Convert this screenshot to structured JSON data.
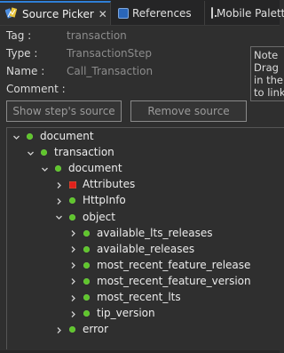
{
  "tabs": [
    {
      "label": "Source Picker",
      "active": true,
      "icon": "source-picker-icon"
    },
    {
      "label": "References",
      "active": false,
      "icon": "references-icon"
    },
    {
      "label": "Mobile Palette",
      "active": false,
      "icon": "mobile-palette-icon"
    }
  ],
  "properties": {
    "tag": {
      "label": "Tag :",
      "value": "transaction"
    },
    "type": {
      "label": "Type :",
      "value": "TransactionStep"
    },
    "name": {
      "label": "Name :",
      "value": "Call_Transaction"
    },
    "comment": {
      "label": "Comment :"
    }
  },
  "note": {
    "lines": [
      "Note",
      "Drag",
      "in the",
      "to link"
    ]
  },
  "buttons": {
    "show_source": "Show step's source",
    "remove_source": "Remove source"
  },
  "tree": [
    {
      "label": "document",
      "depth": 0,
      "expanded": true,
      "icon": "green-dot"
    },
    {
      "label": "transaction",
      "depth": 1,
      "expanded": true,
      "icon": "green-dot"
    },
    {
      "label": "document",
      "depth": 2,
      "expanded": true,
      "icon": "green-dot"
    },
    {
      "label": "Attributes",
      "depth": 3,
      "expanded": false,
      "icon": "red-square"
    },
    {
      "label": "HttpInfo",
      "depth": 3,
      "expanded": false,
      "icon": "green-dot"
    },
    {
      "label": "object",
      "depth": 3,
      "expanded": true,
      "icon": "green-dot"
    },
    {
      "label": "available_lts_releases",
      "depth": 4,
      "expanded": false,
      "icon": "green-dot"
    },
    {
      "label": "available_releases",
      "depth": 4,
      "expanded": false,
      "icon": "green-dot"
    },
    {
      "label": "most_recent_feature_release",
      "depth": 4,
      "expanded": false,
      "icon": "green-dot"
    },
    {
      "label": "most_recent_feature_version",
      "depth": 4,
      "expanded": false,
      "icon": "green-dot"
    },
    {
      "label": "most_recent_lts",
      "depth": 4,
      "expanded": false,
      "icon": "green-dot"
    },
    {
      "label": "tip_version",
      "depth": 4,
      "expanded": false,
      "icon": "green-dot"
    },
    {
      "label": "error",
      "depth": 3,
      "expanded": false,
      "icon": "green-dot"
    }
  ],
  "colors": {
    "background": "#2f2f2f",
    "tab_accent": "#2f7fd6",
    "node_dot": "#5fc52c",
    "attributes_square": "#e0201c",
    "muted_text": "#8c8c8c"
  }
}
